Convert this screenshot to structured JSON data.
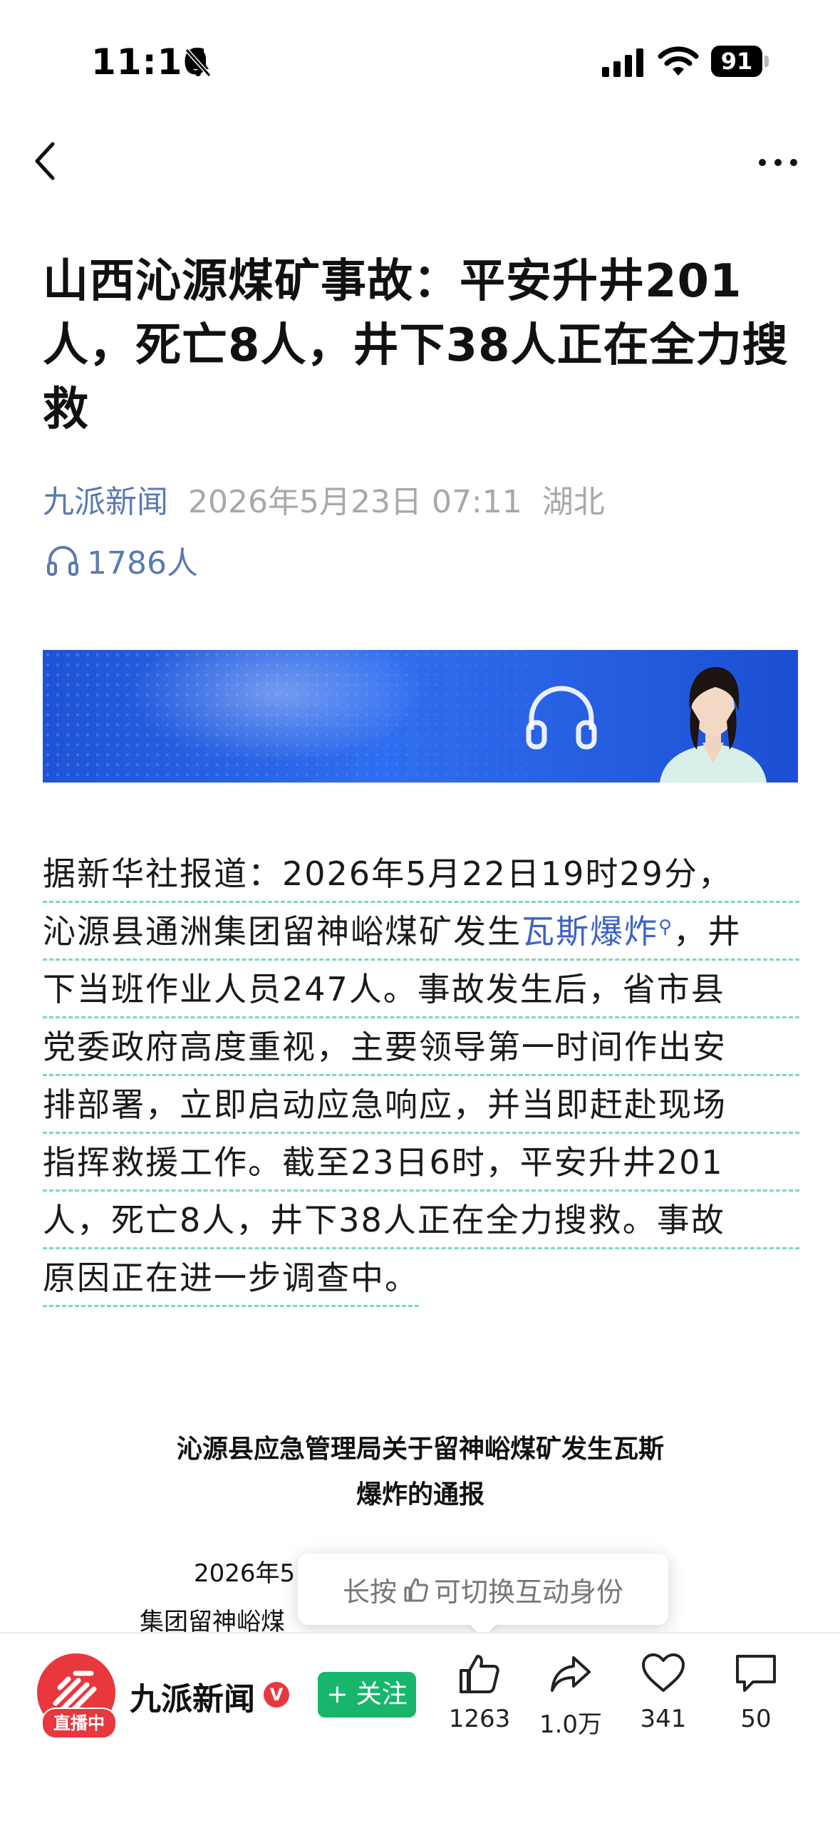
{
  "status_bar": {
    "time": "11:16",
    "battery": "91"
  },
  "nav": {
    "back_icon": "chevron-left-icon",
    "more_icon": "ellipsis-icon"
  },
  "article": {
    "title": "山西沁源煤矿事故：平安升井201人，死亡8人，井下38人正在全力搜救",
    "source": "九派新闻",
    "datetime": "2026年5月23日 07:11",
    "location": "湖北",
    "listeners": "1786人",
    "body_lines": [
      "据新华社报道：2026年5月22日19时29分，",
      "沁源县通洲集团留神峪煤矿发生",
      "下当班作业人员247人。事故发生后，省市县",
      "党委政府高度重视，主要领导第一时间作出安",
      "排部署，立即启动应急响应，并当即赶赴现场",
      "指挥救援工作。截至23日6时，平安升井201",
      "人，死亡8人，井下38人正在全力搜救。事故",
      "原因正在进一步调查中。"
    ],
    "link_text": "瓦斯爆炸",
    "link_suffix": "，井",
    "notice_title_1": "沁源县应急管理局关于留神峪煤矿发生瓦斯",
    "notice_title_2": "爆炸的通报",
    "notice_line_1": "2026年5",
    "notice_line_2": "集团留神峪煤"
  },
  "tooltip": {
    "prefix": "长按",
    "suffix": "可切换互动身份"
  },
  "bottom_bar": {
    "account": "九派新闻",
    "verified": "V",
    "live_badge": "直播中",
    "follow_label": "+ 关注",
    "likes": "1263",
    "shares": "1.0万",
    "favorites": "341",
    "comments": "50"
  },
  "colors": {
    "accent_blue": "#5a7ab0",
    "link": "#3d62c8",
    "follow_green": "#17b66c",
    "live_red": "#e8383d"
  }
}
